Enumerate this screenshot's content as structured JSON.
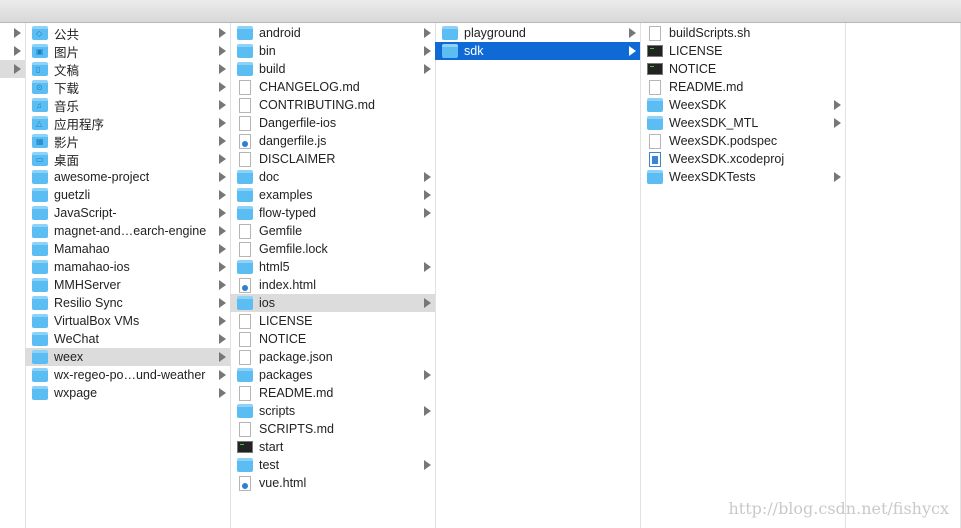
{
  "colors": {
    "folder": "#5cbdf3",
    "selection_blue": "#0f6ad6",
    "selection_gray": "#dcdcdc"
  },
  "columns": [
    {
      "items": [
        {
          "name": "",
          "type": "none",
          "arrow": true
        },
        {
          "name": "",
          "type": "none",
          "arrow": true
        },
        {
          "name": "",
          "type": "none",
          "arrow": true,
          "selected": "gray"
        }
      ]
    },
    {
      "items": [
        {
          "name": "公共",
          "type": "folder",
          "glyph": "◇",
          "arrow": true
        },
        {
          "name": "图片",
          "type": "folder",
          "glyph": "▣",
          "arrow": true
        },
        {
          "name": "文稿",
          "type": "folder",
          "glyph": "▯",
          "arrow": true
        },
        {
          "name": "下载",
          "type": "folder",
          "glyph": "⊙",
          "arrow": true
        },
        {
          "name": "音乐",
          "type": "folder",
          "glyph": "♫",
          "arrow": true
        },
        {
          "name": "应用程序",
          "type": "folder",
          "glyph": "△",
          "arrow": true
        },
        {
          "name": "影片",
          "type": "folder",
          "glyph": "▦",
          "arrow": true
        },
        {
          "name": "桌面",
          "type": "folder",
          "glyph": "▭",
          "arrow": true
        },
        {
          "name": "awesome-project",
          "type": "folder",
          "arrow": true
        },
        {
          "name": "guetzli",
          "type": "folder",
          "arrow": true
        },
        {
          "name": "JavaScript-",
          "type": "folder",
          "arrow": true
        },
        {
          "name": "magnet-and…earch-engine",
          "type": "folder",
          "arrow": true
        },
        {
          "name": "Mamahao",
          "type": "folder",
          "arrow": true
        },
        {
          "name": "mamahao-ios",
          "type": "folder",
          "arrow": true
        },
        {
          "name": "MMHServer",
          "type": "folder",
          "arrow": true
        },
        {
          "name": "Resilio Sync",
          "type": "folder",
          "arrow": true
        },
        {
          "name": "VirtualBox VMs",
          "type": "folder",
          "arrow": true
        },
        {
          "name": "WeChat",
          "type": "folder",
          "arrow": true
        },
        {
          "name": "weex",
          "type": "folder",
          "arrow": true,
          "selected": "gray"
        },
        {
          "name": "wx-regeo-po…und-weather",
          "type": "folder",
          "arrow": true
        },
        {
          "name": "wxpage",
          "type": "folder",
          "arrow": true
        }
      ]
    },
    {
      "items": [
        {
          "name": "android",
          "type": "folder",
          "arrow": true
        },
        {
          "name": "bin",
          "type": "folder",
          "arrow": true
        },
        {
          "name": "build",
          "type": "folder",
          "arrow": true
        },
        {
          "name": "CHANGELOG.md",
          "type": "doc"
        },
        {
          "name": "CONTRIBUTING.md",
          "type": "doc"
        },
        {
          "name": "Dangerfile-ios",
          "type": "doc"
        },
        {
          "name": "dangerfile.js",
          "type": "js"
        },
        {
          "name": "DISCLAIMER",
          "type": "doc"
        },
        {
          "name": "doc",
          "type": "folder",
          "arrow": true
        },
        {
          "name": "examples",
          "type": "folder",
          "arrow": true
        },
        {
          "name": "flow-typed",
          "type": "folder",
          "arrow": true
        },
        {
          "name": "Gemfile",
          "type": "doc"
        },
        {
          "name": "Gemfile.lock",
          "type": "doc"
        },
        {
          "name": "html5",
          "type": "folder",
          "arrow": true
        },
        {
          "name": "index.html",
          "type": "js"
        },
        {
          "name": "ios",
          "type": "folder",
          "arrow": true,
          "selected": "gray"
        },
        {
          "name": "LICENSE",
          "type": "doc"
        },
        {
          "name": "NOTICE",
          "type": "doc"
        },
        {
          "name": "package.json",
          "type": "doc"
        },
        {
          "name": "packages",
          "type": "folder",
          "arrow": true
        },
        {
          "name": "README.md",
          "type": "doc"
        },
        {
          "name": "scripts",
          "type": "folder",
          "arrow": true
        },
        {
          "name": "SCRIPTS.md",
          "type": "doc"
        },
        {
          "name": "start",
          "type": "term"
        },
        {
          "name": "test",
          "type": "folder",
          "arrow": true
        },
        {
          "name": "vue.html",
          "type": "js"
        }
      ]
    },
    {
      "items": [
        {
          "name": "playground",
          "type": "folder",
          "arrow": true
        },
        {
          "name": "sdk",
          "type": "folder",
          "arrow": true,
          "selected": "blue"
        }
      ]
    },
    {
      "items": [
        {
          "name": "buildScripts.sh",
          "type": "doc"
        },
        {
          "name": "LICENSE",
          "type": "term"
        },
        {
          "name": "NOTICE",
          "type": "term"
        },
        {
          "name": "README.md",
          "type": "doc"
        },
        {
          "name": "WeexSDK",
          "type": "folder",
          "arrow": true
        },
        {
          "name": "WeexSDK_MTL",
          "type": "folder",
          "arrow": true
        },
        {
          "name": "WeexSDK.podspec",
          "type": "doc"
        },
        {
          "name": "WeexSDK.xcodeproj",
          "type": "xc"
        },
        {
          "name": "WeexSDKTests",
          "type": "folder",
          "arrow": true
        }
      ]
    },
    {
      "items": []
    }
  ],
  "watermark": "http://blog.csdn.net/fishycx"
}
